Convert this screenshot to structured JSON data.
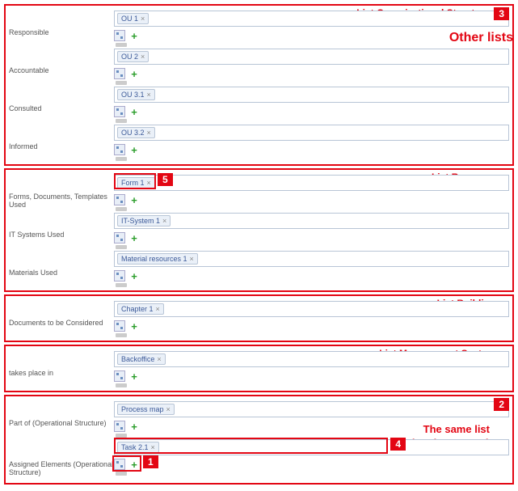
{
  "side_label": "Other lists",
  "callouts": {
    "c1": "1",
    "c2": "2",
    "c3": "3",
    "c4": "4",
    "c5": "5"
  },
  "panels": [
    {
      "title": "List Organizational Structure",
      "rows": [
        {
          "label": "Responsible",
          "tag": "OU 1"
        },
        {
          "label": "Accountable",
          "tag": "OU 2"
        },
        {
          "label": "Consulted",
          "tag": "OU 3.1"
        },
        {
          "label": "Informed",
          "tag": "OU 3.2"
        }
      ]
    },
    {
      "title": "List Resources",
      "rows": [
        {
          "label": "Forms, Documents, Templates Used",
          "tag": "Form 1"
        },
        {
          "label": "IT Systems Used",
          "tag": "IT-System 1"
        },
        {
          "label": "Materials Used",
          "tag": "Material resources 1"
        }
      ]
    },
    {
      "title": "List Buildings",
      "rows": [
        {
          "label": "Documents to be Considered",
          "tag": "Chapter 1"
        }
      ]
    },
    {
      "title": "List Management Systems",
      "rows": [
        {
          "label": "takes place in",
          "tag": "Backoffice"
        }
      ]
    },
    {
      "title": "The same list\n(Operational Structure)",
      "rows": [
        {
          "label": "Part of (Operational Structure)",
          "tag": "Process map"
        },
        {
          "label": "Assigned Elements (Operational Structure)",
          "tag": "Task 2.1"
        }
      ]
    }
  ]
}
